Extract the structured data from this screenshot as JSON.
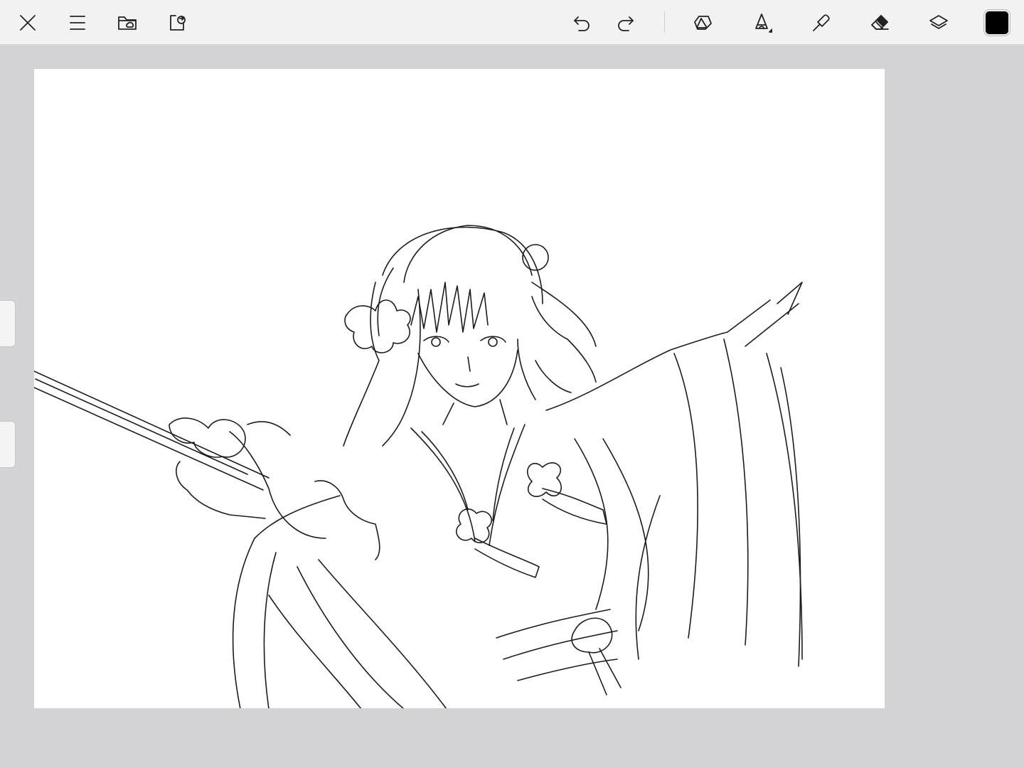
{
  "toolbar": {
    "left_tools": [
      {
        "name": "close-icon"
      },
      {
        "name": "menu-icon"
      },
      {
        "name": "gallery-folder-icon"
      },
      {
        "name": "share-export-icon"
      }
    ],
    "right_tools": [
      {
        "name": "undo-icon"
      },
      {
        "name": "redo-icon"
      },
      {
        "name": "shapes-tool-icon"
      },
      {
        "name": "brush-tool-icon"
      },
      {
        "name": "smudge-tool-icon"
      },
      {
        "name": "eraser-tool-icon"
      },
      {
        "name": "layers-icon"
      }
    ],
    "active_color": "#000000"
  },
  "canvas": {
    "background": "#ffffff",
    "content": "line-art-drawing"
  }
}
